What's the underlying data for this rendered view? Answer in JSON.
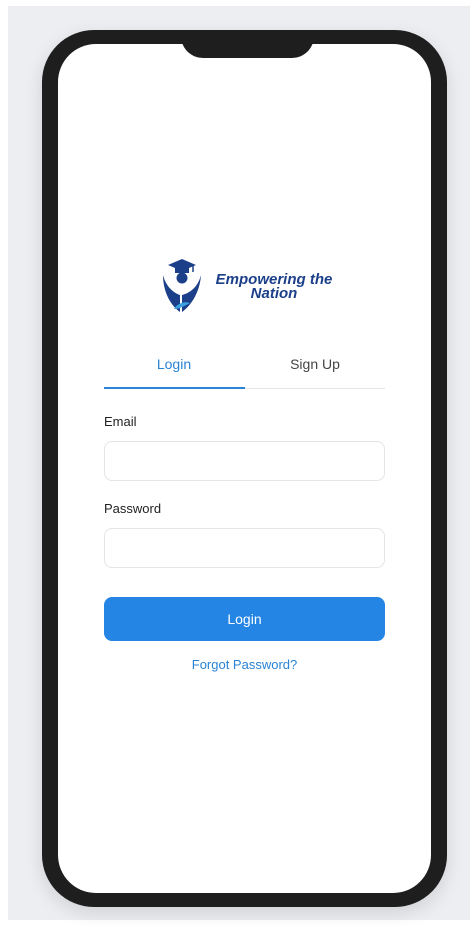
{
  "brand": {
    "line1": "Empowering the",
    "line2": "Nation",
    "color": "#1c3f8a"
  },
  "tabs": [
    {
      "label": "Login",
      "active": true
    },
    {
      "label": "Sign Up",
      "active": false
    }
  ],
  "form": {
    "email": {
      "label": "Email",
      "value": "",
      "placeholder": ""
    },
    "password": {
      "label": "Password",
      "value": "",
      "placeholder": ""
    },
    "submit_label": "Login",
    "forgot_label": "Forgot Password?"
  },
  "theme": {
    "accent": "#2485e4",
    "link": "#2a83d4",
    "device_frame": "#1e1e1e"
  }
}
